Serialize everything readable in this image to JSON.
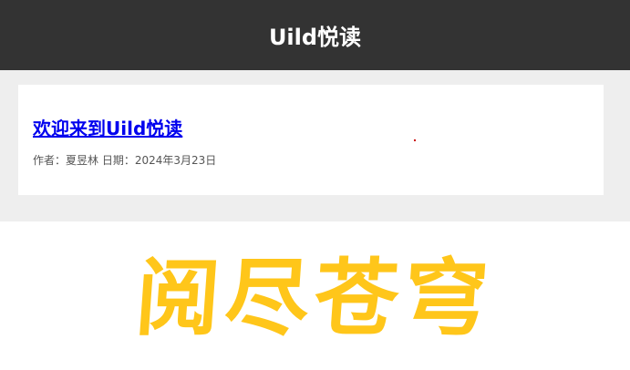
{
  "header": {
    "title": "Uild悦读"
  },
  "post": {
    "title": "欢迎来到Uild悦读",
    "meta": "作者：夏昱林 日期：2024年3月23日"
  },
  "banner": {
    "text": "阅尽苍穹",
    "color": "#ffc61a"
  },
  "colors": {
    "header_bg": "#333333",
    "content_bg": "#eeeeee",
    "link": "#0000ee"
  }
}
